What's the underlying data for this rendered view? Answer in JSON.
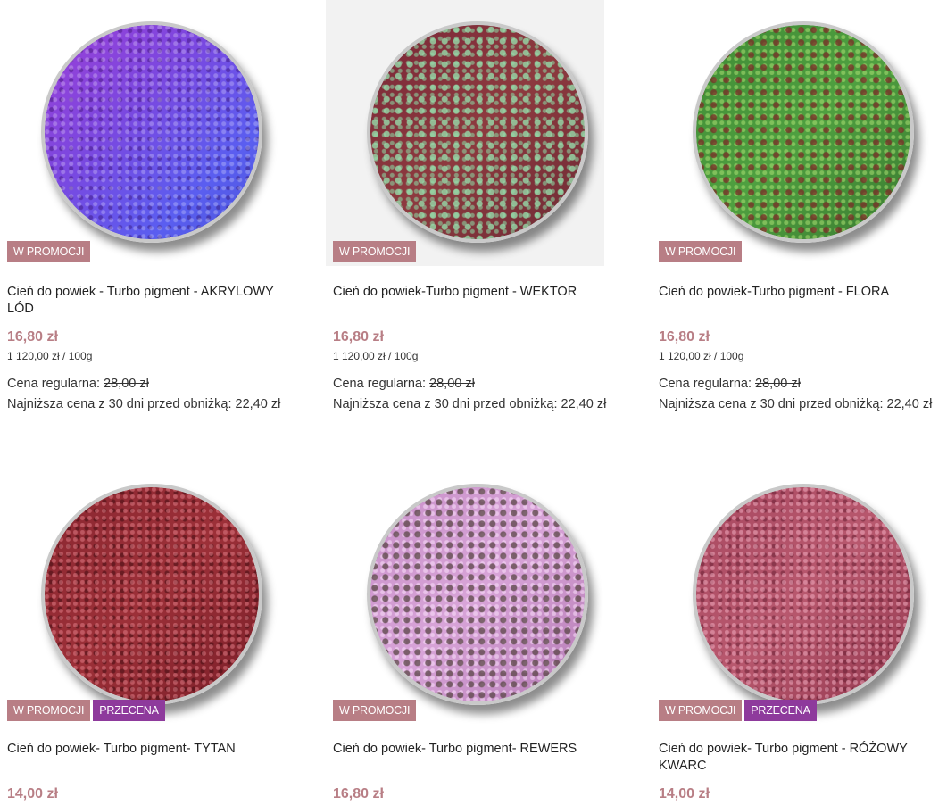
{
  "products": [
    {
      "name": "Cień do powiek - Turbo pigment - AKRYLOWY LÓD",
      "badges": [
        "W PROMOCJI"
      ],
      "price": "16,80 zł",
      "unit_price": "1 120,00 zł / 100g",
      "regular_label": "Cena regularna:",
      "regular_price": "28,00 zł",
      "lowest_price": "Najniższa cena z 30 dni przed obniżką: 22,40 zł",
      "swatch_colors": [
        "#9b3fd6",
        "#5a5ef0"
      ]
    },
    {
      "name": "Cień do powiek-Turbo pigment - WEKTOR",
      "badges": [
        "W PROMOCJI"
      ],
      "price": "16,80 zł",
      "unit_price": "1 120,00 zł / 100g",
      "regular_label": "Cena regularna:",
      "regular_price": "28,00 zł",
      "lowest_price": "Najniższa cena z 30 dni przed obniżką: 22,40 zł",
      "swatch_colors": [
        "#7a2838",
        "#96dcaa"
      ]
    },
    {
      "name": "Cień do powiek-Turbo pigment - FLORA",
      "badges": [
        "W PROMOCJI"
      ],
      "price": "16,80 zł",
      "unit_price": "1 120,00 zł / 100g",
      "regular_label": "Cena regularna:",
      "regular_price": "28,00 zł",
      "lowest_price": "Najniższa cena z 30 dni przed obniżką: 22,40 zł",
      "swatch_colors": [
        "#4fa040",
        "#783228"
      ]
    },
    {
      "name": "Cień do powiek- Turbo pigment- TYTAN",
      "badges": [
        "W PROMOCJI",
        "PRZECENA"
      ],
      "price": "14,00 zł",
      "swatch_colors": [
        "#9c3038",
        "#e6828c"
      ]
    },
    {
      "name": "Cień do powiek- Turbo pigment- REWERS",
      "badges": [
        "W PROMOCJI"
      ],
      "price": "16,80 zł",
      "swatch_colors": [
        "#d8a4d8",
        "#5a4646"
      ]
    },
    {
      "name": "Cień do powiek- Turbo pigment - RÓŻOWY KWARC",
      "badges": [
        "W PROMOCJI",
        "PRZECENA"
      ],
      "price": "14,00 zł",
      "swatch_colors": [
        "#b8586e",
        "#f0aabe"
      ]
    }
  ],
  "colors": {
    "promo_badge": "#b87e85",
    "sale_badge": "#8e3a9c",
    "price": "#b87e85"
  }
}
